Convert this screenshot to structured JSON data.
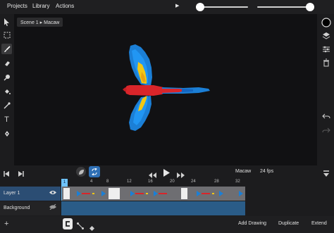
{
  "menu": {
    "projects": "Projects",
    "library": "Library",
    "actions": "Actions"
  },
  "topbar": {
    "play_icon": "play-icon",
    "slider1_level": 0.0,
    "slider2_level": 1.0
  },
  "tools_left": [
    "select-arrow-icon",
    "marquee-select-icon",
    "brush-icon",
    "eraser-icon",
    "smudge-icon",
    "fill-bucket-icon",
    "eyedropper-icon",
    "text-icon",
    "pen-icon"
  ],
  "tools_right": [
    "color-swatch-icon",
    "layers-icon",
    "sliders-icon",
    "trash-icon",
    "undo-icon",
    "redo-icon"
  ],
  "breadcrumb": {
    "scene": "Scene 1",
    "sep": "▸",
    "symbol": "Macaw"
  },
  "playback": {
    "name": "Macaw",
    "fps": "24 fps"
  },
  "timeline": {
    "ruler": [
      "1",
      "4",
      "8",
      "12",
      "16",
      "20",
      "24",
      "28",
      "32"
    ],
    "layers": [
      {
        "label": "Layer 1",
        "visible": true
      },
      {
        "label": "Background",
        "visible": false
      }
    ],
    "playhead_frame": 1
  },
  "bottom": {
    "add_drawing": "Add Drawing",
    "duplicate": "Duplicate",
    "extend": "Extend"
  },
  "colors": {
    "accent": "#2e6fb5",
    "macaw_red": "#d9252a",
    "macaw_yellow": "#f2c713",
    "macaw_blue": "#1b7fd6"
  }
}
